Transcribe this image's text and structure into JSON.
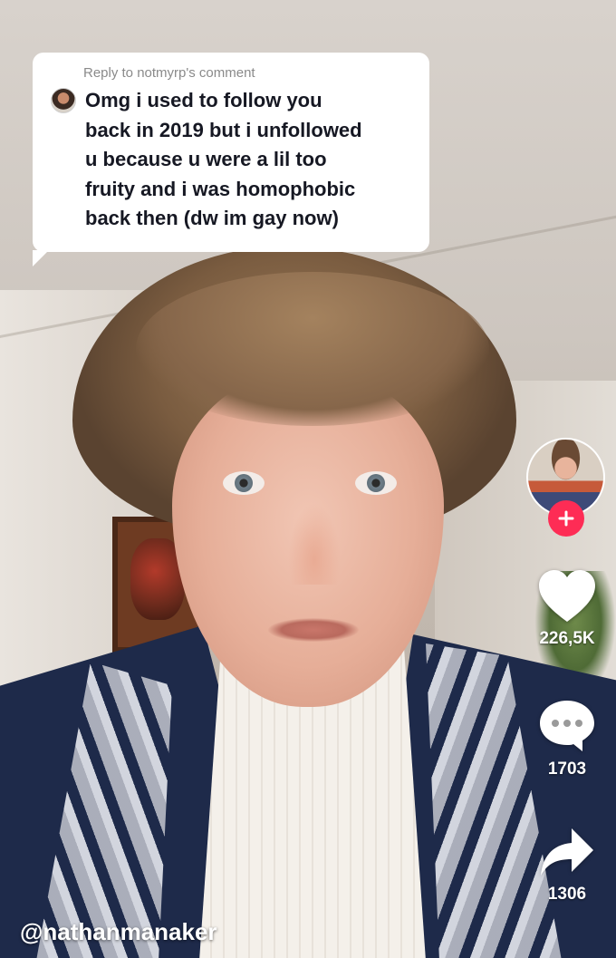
{
  "reply": {
    "header": "Reply to notmyrp's comment",
    "lines": [
      "Omg i used to follow you",
      "back in 2019 but i unfollowed",
      "u because u were a lil too",
      "fruity and i was homophobic",
      "back then (dw im gay now)"
    ]
  },
  "actions": {
    "likes": "226,5K",
    "comments": "1703",
    "shares": "1306"
  },
  "creator": {
    "username": "@nathanmanaker"
  },
  "colors": {
    "follow_accent": "#fe2c55",
    "bubble_bg": "#ffffff",
    "bubble_text": "#161823",
    "bubble_subtext": "#8a8a8a"
  },
  "icons": {
    "follow": "plus-icon",
    "like": "heart-icon",
    "comment": "comment-bubble-icon",
    "share": "share-arrow-icon"
  }
}
